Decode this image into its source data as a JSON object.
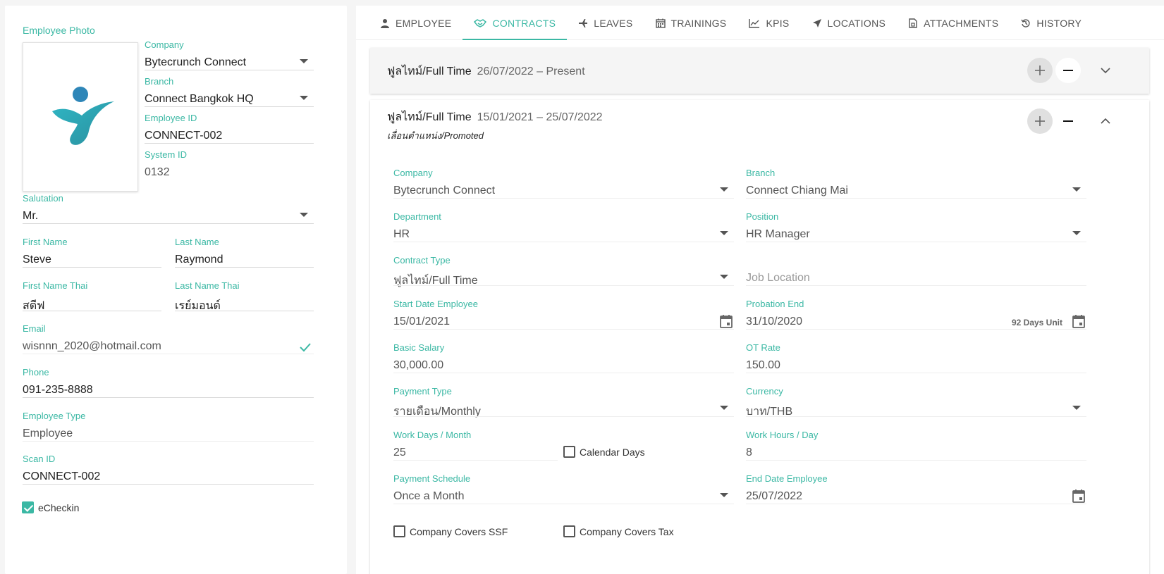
{
  "left": {
    "photo_label": "Employee Photo",
    "company": {
      "label": "Company",
      "value": "Bytecrunch Connect"
    },
    "branch": {
      "label": "Branch",
      "value": "Connect Bangkok HQ"
    },
    "employee_id": {
      "label": "Employee ID",
      "value": "CONNECT-002"
    },
    "system_id": {
      "label": "System ID",
      "value": "0132"
    },
    "salutation": {
      "label": "Salutation",
      "value": "Mr."
    },
    "first_name": {
      "label": "First Name",
      "value": "Steve"
    },
    "last_name": {
      "label": "Last Name",
      "value": "Raymond"
    },
    "first_name_thai": {
      "label": "First Name Thai",
      "value": "สตีฟ"
    },
    "last_name_thai": {
      "label": "Last Name Thai",
      "value": "เรย์มอนด์"
    },
    "email": {
      "label": "Email",
      "value": "wisnnn_2020@hotmail.com"
    },
    "phone": {
      "label": "Phone",
      "value": "091-235-8888"
    },
    "employee_type": {
      "label": "Employee Type",
      "value": "Employee"
    },
    "scan_id": {
      "label": "Scan ID",
      "value": "CONNECT-002"
    },
    "echeckin": {
      "label": "eCheckin",
      "checked": true
    }
  },
  "tabs": [
    {
      "label": "EMPLOYEE",
      "icon": "person-icon"
    },
    {
      "label": "CONTRACTS",
      "icon": "handshake-icon",
      "active": true
    },
    {
      "label": "LEAVES",
      "icon": "plane-icon"
    },
    {
      "label": "TRAININGS",
      "icon": "calendar-icon"
    },
    {
      "label": "KPIS",
      "icon": "chart-line-icon"
    },
    {
      "label": "LOCATIONS",
      "icon": "location-arrow-icon"
    },
    {
      "label": "ATTACHMENTS",
      "icon": "file-icon"
    },
    {
      "label": "HISTORY",
      "icon": "history-icon"
    }
  ],
  "contracts": [
    {
      "type": "ฟูลไทม์/Full Time",
      "dates": "26/07/2022 – Present",
      "collapsed": true
    },
    {
      "type": "ฟูลไทม์/Full Time",
      "dates": "15/01/2021 – 25/07/2022",
      "note": "เลื่อนตำแหน่ง/Promoted",
      "fields": {
        "company": {
          "label": "Company",
          "value": "Bytecrunch Connect"
        },
        "branch": {
          "label": "Branch",
          "value": "Connect Chiang Mai"
        },
        "department": {
          "label": "Department",
          "value": "HR"
        },
        "position": {
          "label": "Position",
          "value": "HR Manager"
        },
        "contract_type": {
          "label": "Contract Type",
          "value": "ฟูลไทม์/Full Time"
        },
        "job_location": {
          "placeholder": "Job Location"
        },
        "start_date": {
          "label": "Start Date Employee",
          "value": "15/01/2021"
        },
        "probation_end": {
          "label": "Probation End",
          "value": "31/10/2020",
          "unit": "92 Days Unit"
        },
        "basic_salary": {
          "label": "Basic Salary",
          "value": "30,000.00"
        },
        "ot_rate": {
          "label": "OT Rate",
          "value": "150.00"
        },
        "payment_type": {
          "label": "Payment Type",
          "value": "รายเดือน/Monthly"
        },
        "currency": {
          "label": "Currency",
          "value": "บาท/THB"
        },
        "work_days": {
          "label": "Work Days / Month",
          "value": "25"
        },
        "calendar_days": {
          "label": "Calendar Days",
          "checked": false
        },
        "work_hours": {
          "label": "Work Hours / Day",
          "value": "8"
        },
        "payment_schedule": {
          "label": "Payment Schedule",
          "value": "Once a Month"
        },
        "end_date": {
          "label": "End Date Employee",
          "value": "25/07/2022"
        },
        "covers_ssf": {
          "label": "Company Covers SSF",
          "checked": false
        },
        "covers_tax": {
          "label": "Company Covers Tax",
          "checked": false
        }
      }
    }
  ],
  "colors": {
    "accent": "#3bb8a4",
    "text": "#222222"
  }
}
